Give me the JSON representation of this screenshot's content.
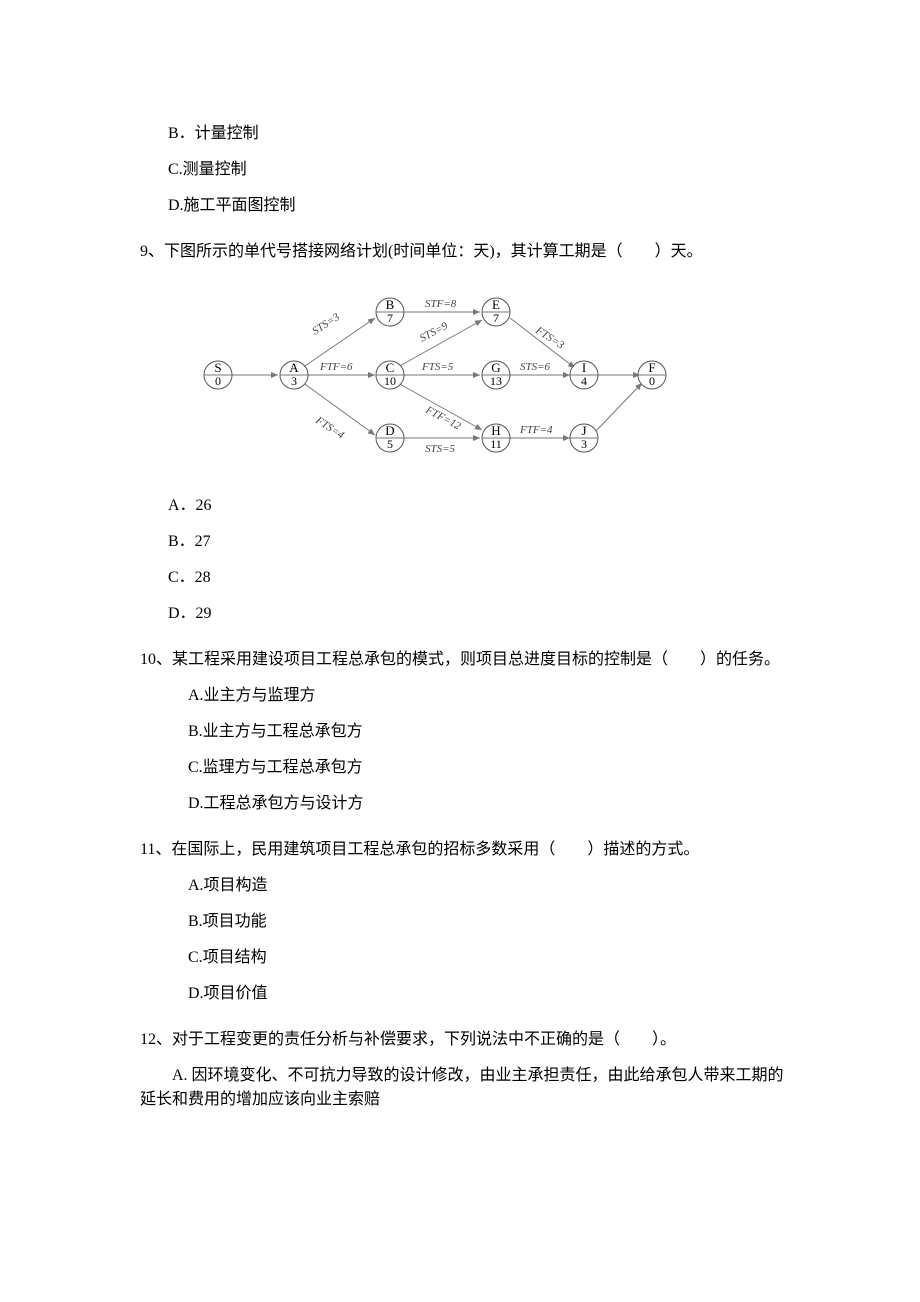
{
  "opt_b1": "B．计量控制",
  "opt_c1": "C.测量控制",
  "opt_d1": "D.施工平面图控制",
  "q9": "9、下图所示的单代号搭接网络计划(时间单位：天)，其计算工期是（　　）天。",
  "q9_a": "A．26",
  "q9_b": "B．27",
  "q9_c": "C．28",
  "q9_d": "D．29",
  "q10": "10、某工程采用建设项目工程总承包的模式，则项目总进度目标的控制是（　　）的任务。",
  "q10_a": "A.业主方与监理方",
  "q10_b": "B.业主方与工程总承包方",
  "q10_c": "C.监理方与工程总承包方",
  "q10_d": "D.工程总承包方与设计方",
  "q11": "11、在国际上，民用建筑项目工程总承包的招标多数采用（　　）描述的方式。",
  "q11_a": "A.项目构造",
  "q11_b": "B.项目功能",
  "q11_c": "C.项目结构",
  "q11_d": "D.项目价值",
  "q12": "12、对于工程变更的责任分析与补偿要求，下列说法中不正确的是（　　）。",
  "q12_a": "　　A. 因环境变化、不可抗力导致的设计修改，由业主承担责任，由此给承包人带来工期的延长和费用的增加应该向业主索赔",
  "nodes": {
    "S": {
      "dur": "0"
    },
    "A": {
      "dur": "3"
    },
    "B": {
      "dur": "7"
    },
    "C": {
      "dur": "10"
    },
    "D": {
      "dur": "5"
    },
    "E": {
      "dur": "7"
    },
    "G": {
      "dur": "13"
    },
    "H": {
      "dur": "11"
    },
    "I": {
      "dur": "4"
    },
    "J": {
      "dur": "3"
    },
    "F": {
      "dur": "0"
    }
  },
  "edges": {
    "AB": "STS=3",
    "AC": "FTF=6",
    "AD": "FTS=4",
    "BE": "STF=8",
    "CE": "STS=9",
    "CG": "FTS=5",
    "CH": "FTF=12",
    "DH": "STS=5",
    "EI": "FTS=3",
    "GI": "STS=6",
    "HJ": "FTF=4"
  }
}
